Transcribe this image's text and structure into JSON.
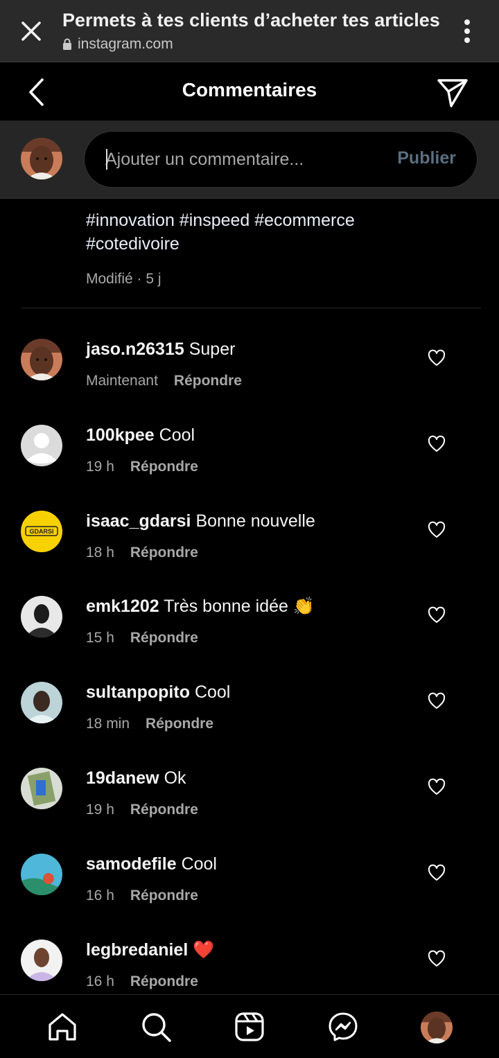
{
  "custom_tab": {
    "title": "Permets à tes clients d’acheter tes articles",
    "url": "instagram.com"
  },
  "header": {
    "title": "Commentaires"
  },
  "composer": {
    "placeholder": "Ajouter un commentaire...",
    "publish_label": "Publier"
  },
  "caption": {
    "text_line1": "#innovation #inspeed #ecommerce",
    "text_line2": "#cotedivoire",
    "meta": "Modifié · 5 j"
  },
  "comments": [
    {
      "user": "jaso.n26315",
      "text": "Super",
      "time": "Maintenant",
      "reply": "Répondre",
      "avatar": "photo-man-1"
    },
    {
      "user": "100kpee",
      "text": "Cool",
      "time": "19 h",
      "reply": "Répondre",
      "avatar": "default-user"
    },
    {
      "user": "isaac_gdarsi",
      "text": "Bonne nouvelle",
      "time": "18 h",
      "reply": "Répondre",
      "avatar": "gdarsi-logo"
    },
    {
      "user": "emk1202",
      "text": "Très bonne idée 👏",
      "time": "15 h",
      "reply": "Répondre",
      "avatar": "photo-man-2"
    },
    {
      "user": "sultanpopito",
      "text": "Cool",
      "time": "18 min",
      "reply": "Répondre",
      "avatar": "photo-man-3"
    },
    {
      "user": "19danew",
      "text": "Ok",
      "time": "19 h",
      "reply": "Répondre",
      "avatar": "photo-scene-1"
    },
    {
      "user": "samodefile",
      "text": "Cool",
      "time": "16 h",
      "reply": "Répondre",
      "avatar": "photo-scene-2"
    },
    {
      "user": "legbredaniel",
      "text": "❤️",
      "time": "16 h",
      "reply": "Répondre",
      "avatar": "photo-man-4"
    }
  ],
  "gdarsi_logo_text": "GDARSI",
  "colors": {
    "background": "#000000",
    "tab_bar": "#2a2a2a",
    "composer_bg": "#262626",
    "publish_disabled": "#5b6f80",
    "muted_text": "#a8a8a8",
    "gdarsi_yellow": "#f7d100"
  },
  "bottom_nav": {
    "items": [
      "home-icon",
      "search-icon",
      "reels-icon",
      "messenger-icon",
      "profile-avatar"
    ]
  }
}
